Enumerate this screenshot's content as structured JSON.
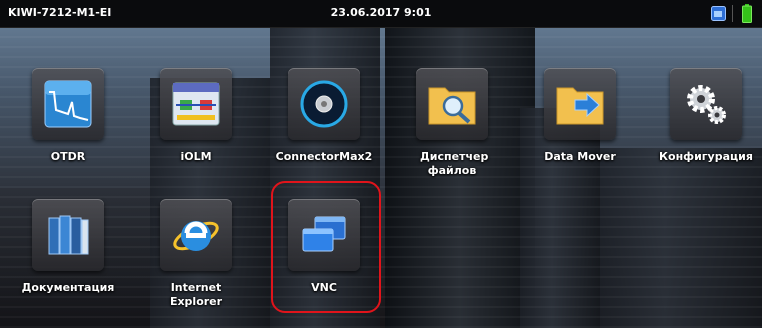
{
  "statusbar": {
    "device_name": "KIWI-7212-M1-EI",
    "datetime": "23.06.2017 9:01"
  },
  "apps": [
    {
      "label": "OTDR",
      "icon": "otdr-trace-icon"
    },
    {
      "label": "iOLM",
      "icon": "iolm-icon"
    },
    {
      "label": "ConnectorMax2",
      "icon": "connector-icon"
    },
    {
      "label": "Диспетчер файлов",
      "icon": "file-manager-icon"
    },
    {
      "label": "Data Mover",
      "icon": "data-mover-icon"
    },
    {
      "label": "Конфигурация",
      "icon": "gears-icon"
    },
    {
      "label": "Документация",
      "icon": "books-icon"
    },
    {
      "label": "Internet Explorer",
      "icon": "internet-explorer-icon"
    },
    {
      "label": "VNC",
      "icon": "vnc-windows-icon"
    }
  ],
  "colors": {
    "highlight": "#e0141b",
    "battery": "#35c21a"
  }
}
